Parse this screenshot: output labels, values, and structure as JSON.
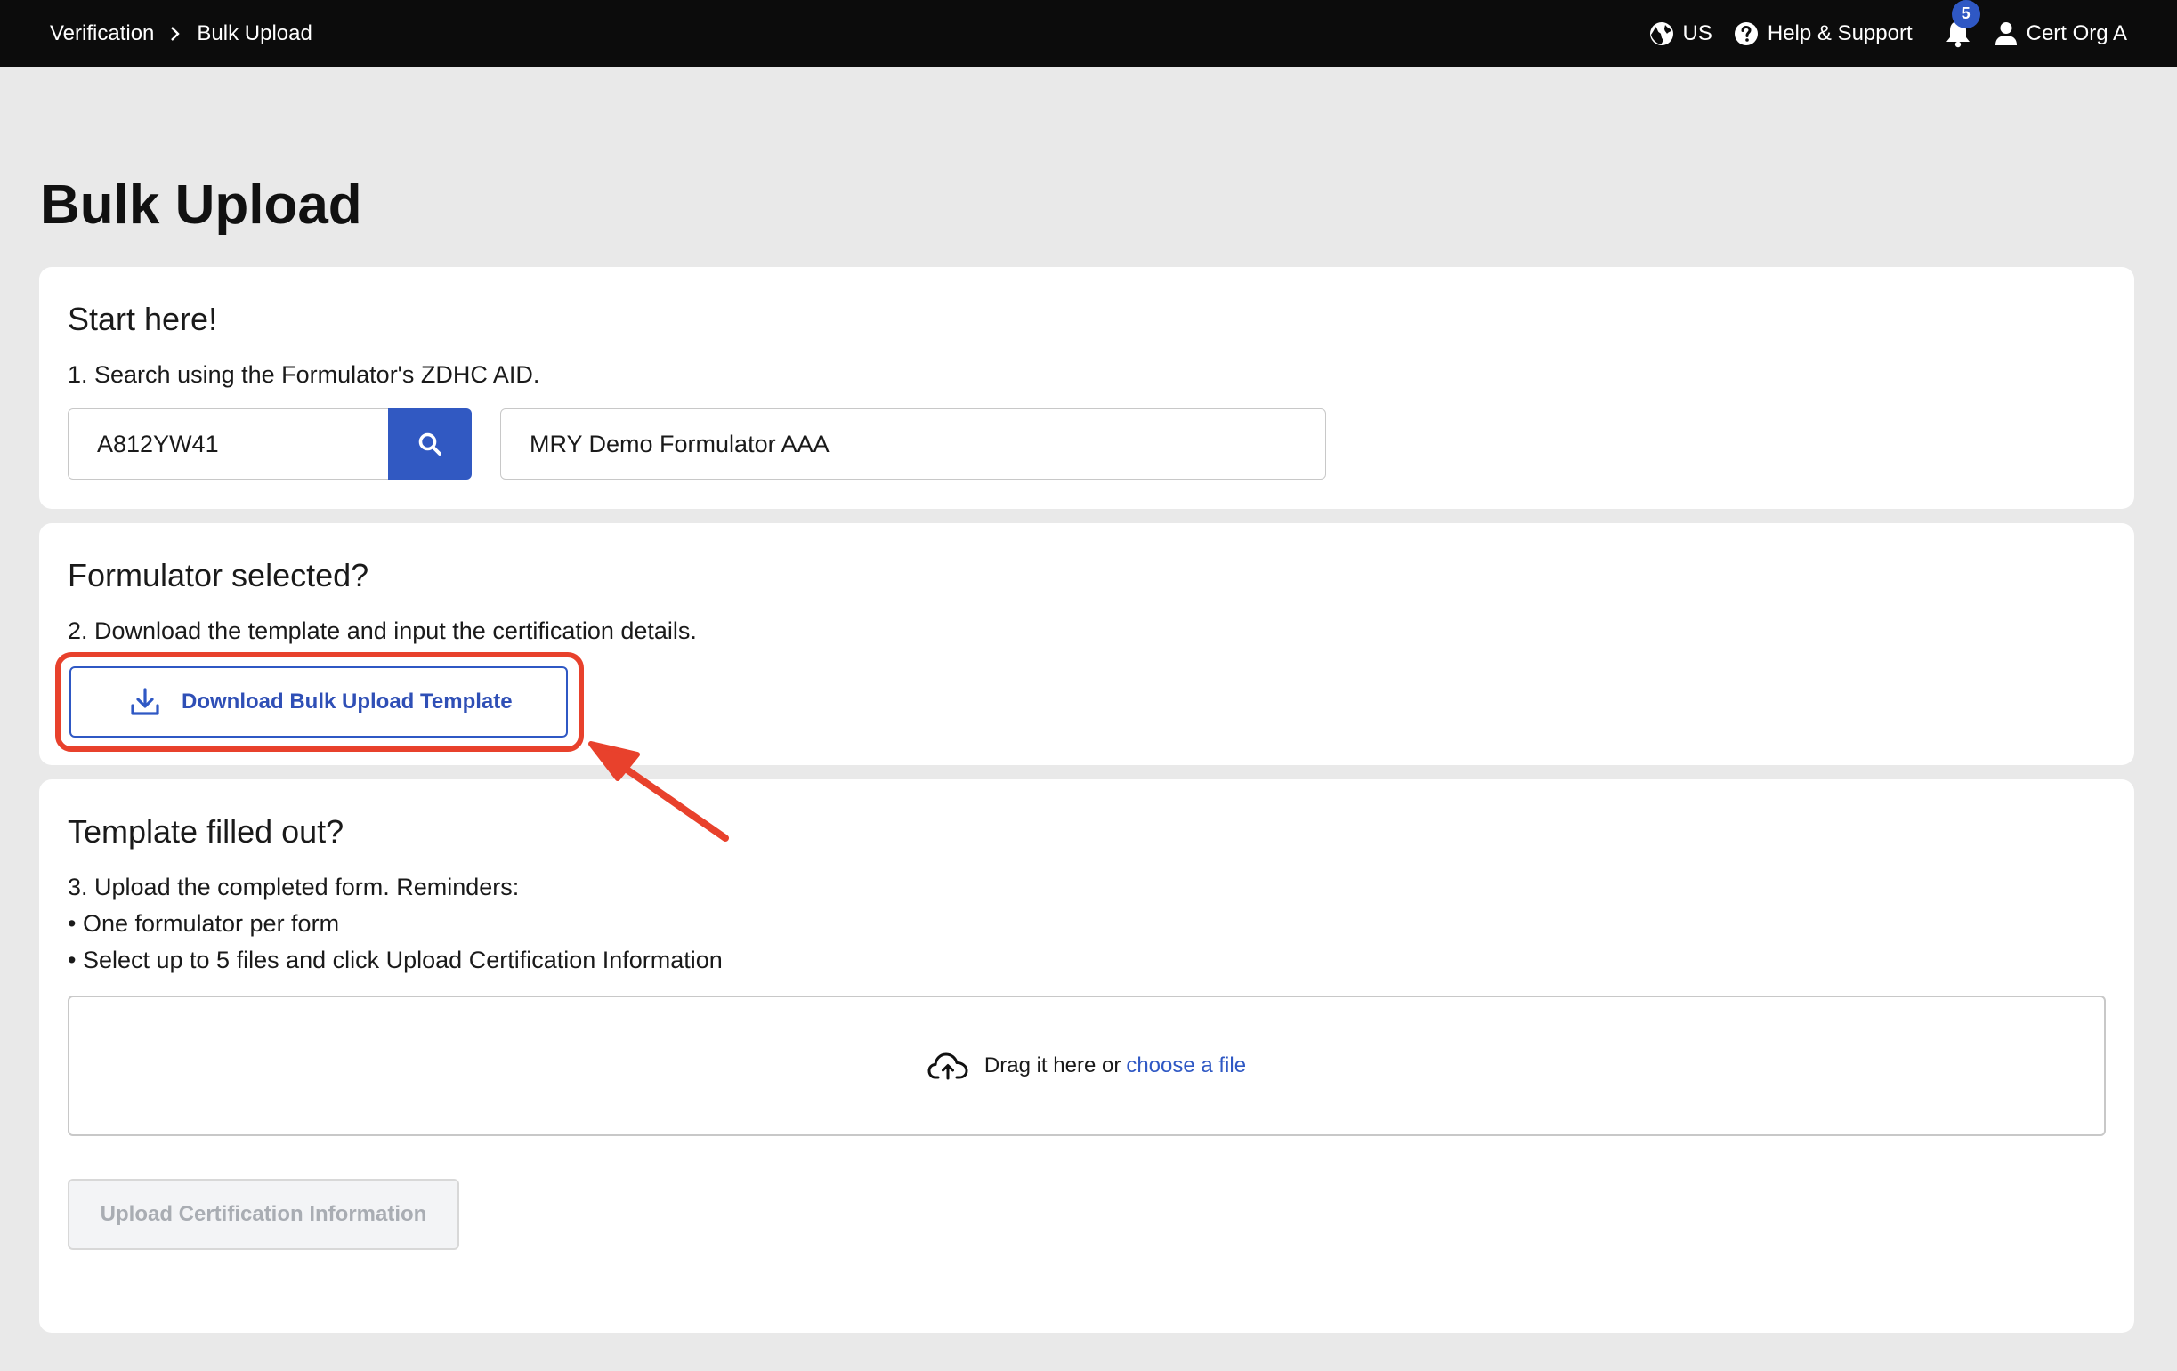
{
  "header": {
    "breadcrumb": [
      "Verification",
      "Bulk Upload"
    ],
    "region": "US",
    "help_label": "Help & Support",
    "notification_count": "5",
    "user_name": "Cert Org A"
  },
  "page": {
    "title": "Bulk Upload"
  },
  "step1": {
    "heading": "Start here!",
    "instruction": "1. Search using the Formulator's ZDHC AID.",
    "aid_value": "A812YW41",
    "formulator_name": "MRY Demo Formulator AAA"
  },
  "step2": {
    "heading": "Formulator selected?",
    "instruction": "2. Download the template and input the certification details.",
    "download_label": "Download Bulk Upload Template"
  },
  "step3": {
    "heading": "Template filled out?",
    "instruction": "3. Upload the completed form. Reminders:",
    "reminders": [
      "• One formulator per form",
      "• Select up to 5 files and click Upload Certification Information"
    ],
    "drop_text": "Drag it here or",
    "drop_link": "choose a file",
    "upload_label": "Upload Certification Information"
  },
  "colors": {
    "accent": "#3159c2",
    "annotation": "#e8412c",
    "topbar": "#0c0c0c"
  }
}
